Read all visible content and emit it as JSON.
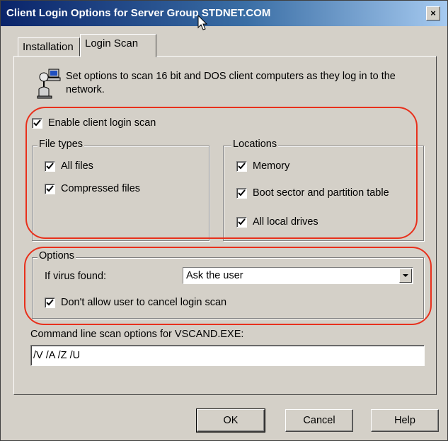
{
  "window": {
    "title": "Client Login Options for Server Group STDNET.COM",
    "close_label": "×"
  },
  "tabs": [
    {
      "label": "Installation",
      "active": false
    },
    {
      "label": "Login Scan",
      "active": true
    }
  ],
  "intro": {
    "text": "Set options to scan 16 bit and DOS client computers as they log in to the network.",
    "icon": "computer-scan-icon"
  },
  "enable_scan": {
    "label": "Enable client login scan",
    "checked": true
  },
  "file_types": {
    "label": "File types",
    "items": [
      {
        "label": "All files",
        "checked": true
      },
      {
        "label": "Compressed files",
        "checked": true
      }
    ]
  },
  "locations": {
    "label": "Locations",
    "items": [
      {
        "label": "Memory",
        "checked": true
      },
      {
        "label": "Boot sector and partition table",
        "checked": true
      },
      {
        "label": "All local drives",
        "checked": true
      }
    ]
  },
  "options": {
    "label": "Options",
    "virus_found_label": "If virus found:",
    "virus_found_value": "Ask the user",
    "no_cancel": {
      "label": "Don't allow user to cancel login scan",
      "checked": true
    }
  },
  "command_line": {
    "label": "Command line scan options for VSCAND.EXE:",
    "value": "/V /A /Z /U"
  },
  "buttons": {
    "ok": "OK",
    "cancel": "Cancel",
    "help": "Help"
  },
  "colors": {
    "annotation": "#e8301c",
    "titlebar_start": "#0a246a",
    "face": "#d4d0c8"
  }
}
